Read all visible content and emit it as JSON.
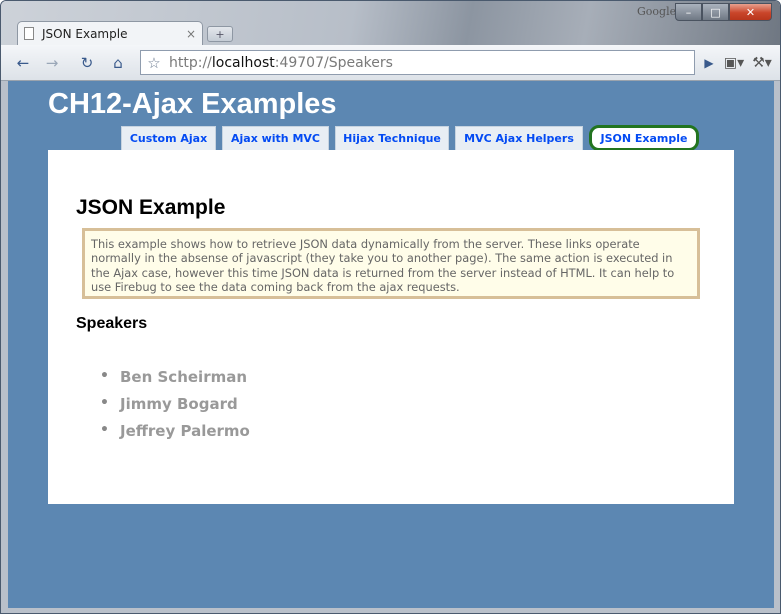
{
  "browser": {
    "branding": "Google",
    "tab_title": "JSON Example",
    "tab_close_glyph": "×",
    "new_tab_glyph": "+",
    "url_scheme": "http://",
    "url_host": "localhost",
    "url_rest": ":49707/Speakers",
    "window_controls": {
      "minimize": "–",
      "maximize": "□",
      "close": "✕"
    }
  },
  "site": {
    "title": "CH12-Ajax Examples",
    "menu": [
      {
        "label": "Custom Ajax",
        "selected": false
      },
      {
        "label": "Ajax with MVC",
        "selected": false
      },
      {
        "label": "Hijax Technique",
        "selected": false
      },
      {
        "label": "MVC Ajax Helpers",
        "selected": false
      },
      {
        "label": "JSON Example",
        "selected": true
      }
    ]
  },
  "page": {
    "heading": "JSON Example",
    "info": "This example shows how to retrieve JSON data dynamically from the server. These links operate normally in the absense of javascript (they take you to another page). The same action is executed in the Ajax case, however this time JSON data is returned from the server instead of HTML. It can help to use Firebug to see the data coming back from the ajax requests.",
    "speakers_heading": "Speakers",
    "speakers": [
      "Ben Scheirman",
      "Jimmy Bogard",
      "Jeffrey Palermo"
    ]
  },
  "colors": {
    "page_background": "#5c87b2",
    "menu_link": "#034af3",
    "selected_border": "#22741f",
    "info_background": "#fffde9",
    "info_border": "#d7bf98"
  },
  "icons": [
    "page-icon",
    "back-icon",
    "forward-icon",
    "reload-icon",
    "home-icon",
    "star-icon",
    "go-icon",
    "page-menu-icon",
    "wrench-icon"
  ]
}
